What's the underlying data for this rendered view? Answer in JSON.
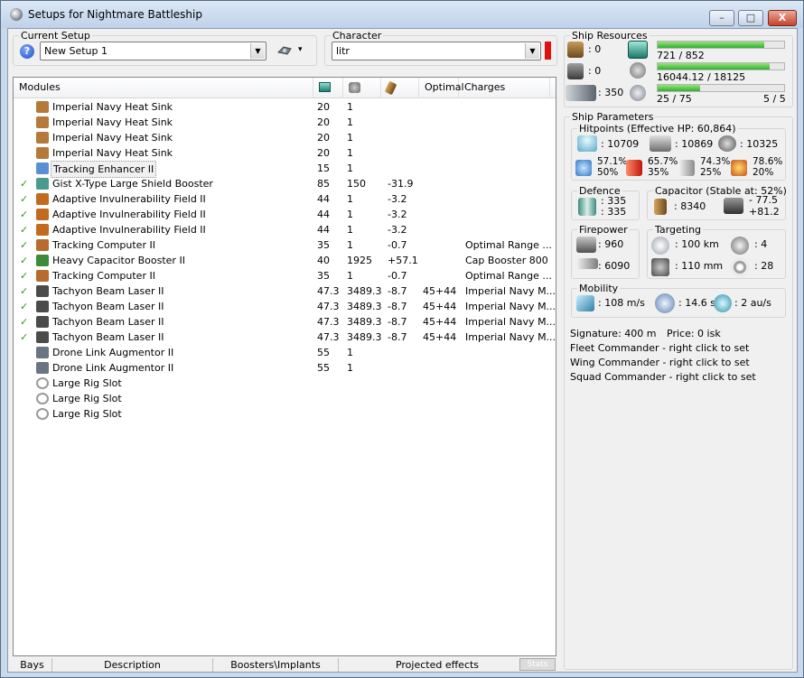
{
  "window": {
    "title": "Setups for Nightmare Battleship",
    "minimize": "–",
    "maximize": "□",
    "close": "X"
  },
  "current_setup": {
    "label": "Current Setup",
    "help": "?",
    "value": "New Setup 1",
    "drone_menu": "▾"
  },
  "character": {
    "label": "Character",
    "value": "litr",
    "indicator_color": "#e01010"
  },
  "modules": {
    "headers": [
      "Modules",
      "",
      "",
      "",
      "Optimal",
      "Charges"
    ],
    "header_icons": [
      "cpu-icon",
      "powergrid-icon",
      "capacitor-icon"
    ],
    "rows": [
      {
        "check": "",
        "icon": "heat-sink-icon",
        "name": "Imperial Navy Heat Sink",
        "c1": "20",
        "c2": "1",
        "c3": "",
        "c4": "",
        "c5": ""
      },
      {
        "check": "",
        "icon": "heat-sink-icon",
        "name": "Imperial Navy Heat Sink",
        "c1": "20",
        "c2": "1",
        "c3": "",
        "c4": "",
        "c5": ""
      },
      {
        "check": "",
        "icon": "heat-sink-icon",
        "name": "Imperial Navy Heat Sink",
        "c1": "20",
        "c2": "1",
        "c3": "",
        "c4": "",
        "c5": ""
      },
      {
        "check": "",
        "icon": "heat-sink-icon",
        "name": "Imperial Navy Heat Sink",
        "c1": "20",
        "c2": "1",
        "c3": "",
        "c4": "",
        "c5": ""
      },
      {
        "check": "",
        "icon": "tracking-enhancer-icon",
        "name": "Tracking Enhancer II",
        "c1": "15",
        "c2": "1",
        "c3": "",
        "c4": "",
        "c5": "",
        "selected": true
      },
      {
        "check": "✓",
        "icon": "shield-booster-icon",
        "name": "Gist X-Type Large Shield Booster",
        "c1": "85",
        "c2": "150",
        "c3": "-31.9",
        "c4": "",
        "c5": ""
      },
      {
        "check": "✓",
        "icon": "invulnerability-field-icon",
        "name": "Adaptive Invulnerability Field II",
        "c1": "44",
        "c2": "1",
        "c3": "-3.2",
        "c4": "",
        "c5": ""
      },
      {
        "check": "✓",
        "icon": "invulnerability-field-icon",
        "name": "Adaptive Invulnerability Field II",
        "c1": "44",
        "c2": "1",
        "c3": "-3.2",
        "c4": "",
        "c5": ""
      },
      {
        "check": "✓",
        "icon": "invulnerability-field-icon",
        "name": "Adaptive Invulnerability Field II",
        "c1": "44",
        "c2": "1",
        "c3": "-3.2",
        "c4": "",
        "c5": ""
      },
      {
        "check": "✓",
        "icon": "tracking-computer-icon",
        "name": "Tracking Computer II",
        "c1": "35",
        "c2": "1",
        "c3": "-0.7",
        "c4": "",
        "c5": "Optimal Range ..."
      },
      {
        "check": "✓",
        "icon": "capacitor-booster-icon",
        "name": "Heavy Capacitor Booster II",
        "c1": "40",
        "c2": "1925",
        "c3": "+57.1",
        "c4": "",
        "c5": "Cap Booster 800"
      },
      {
        "check": "✓",
        "icon": "tracking-computer-icon",
        "name": "Tracking Computer II",
        "c1": "35",
        "c2": "1",
        "c3": "-0.7",
        "c4": "",
        "c5": "Optimal Range ..."
      },
      {
        "check": "✓",
        "icon": "beam-laser-icon",
        "name": "Tachyon Beam Laser II",
        "c1": "47.3",
        "c2": "3489.3",
        "c3": "-8.7",
        "c4": "45+44",
        "c5": "Imperial Navy M..."
      },
      {
        "check": "✓",
        "icon": "beam-laser-icon",
        "name": "Tachyon Beam Laser II",
        "c1": "47.3",
        "c2": "3489.3",
        "c3": "-8.7",
        "c4": "45+44",
        "c5": "Imperial Navy M..."
      },
      {
        "check": "✓",
        "icon": "beam-laser-icon",
        "name": "Tachyon Beam Laser II",
        "c1": "47.3",
        "c2": "3489.3",
        "c3": "-8.7",
        "c4": "45+44",
        "c5": "Imperial Navy M..."
      },
      {
        "check": "✓",
        "icon": "beam-laser-icon",
        "name": "Tachyon Beam Laser II",
        "c1": "47.3",
        "c2": "3489.3",
        "c3": "-8.7",
        "c4": "45+44",
        "c5": "Imperial Navy M..."
      },
      {
        "check": "",
        "icon": "drone-link-icon",
        "name": "Drone Link Augmentor II",
        "c1": "55",
        "c2": "1",
        "c3": "",
        "c4": "",
        "c5": ""
      },
      {
        "check": "",
        "icon": "drone-link-icon",
        "name": "Drone Link Augmentor II",
        "c1": "55",
        "c2": "1",
        "c3": "",
        "c4": "",
        "c5": ""
      },
      {
        "check": "",
        "icon": "rig-slot-icon",
        "name": "Large Rig Slot",
        "c1": "",
        "c2": "",
        "c3": "",
        "c4": "",
        "c5": ""
      },
      {
        "check": "",
        "icon": "rig-slot-icon",
        "name": "Large Rig Slot",
        "c1": "",
        "c2": "",
        "c3": "",
        "c4": "",
        "c5": ""
      },
      {
        "check": "",
        "icon": "rig-slot-icon",
        "name": "Large Rig Slot",
        "c1": "",
        "c2": "",
        "c3": "",
        "c4": "",
        "c5": ""
      }
    ]
  },
  "bottom_tabs": [
    "Bays",
    "Description",
    "Boosters\\Implants",
    "Projected effects"
  ],
  "stats_button": "Stats",
  "ship_resources": {
    "label": "Ship Resources",
    "turret_slots": ": 0",
    "launcher_slots": ": 0",
    "drone_bay": ": 350",
    "cpu": {
      "text": "721 / 852",
      "fraction": 0.846
    },
    "powergrid": {
      "text": "16044.12 / 18125",
      "fraction": 0.885
    },
    "drone_bandwidth": {
      "text": "25 / 75",
      "fraction": 0.333,
      "drones_active": "5 / 5"
    }
  },
  "ship_parameters": {
    "label": "Ship Parameters",
    "hitpoints": {
      "label": "Hitpoints (Effective HP: 60,864)",
      "shield": ": 10709",
      "armor": ": 10869",
      "hull": ": 10325",
      "resists": [
        {
          "top": "57.1%",
          "bottom": "50%"
        },
        {
          "top": "65.7%",
          "bottom": "35%"
        },
        {
          "top": "74.3%",
          "bottom": "25%"
        },
        {
          "top": "78.6%",
          "bottom": "20%"
        }
      ]
    },
    "defence": {
      "label": "Defence",
      "top": ": 335",
      "bottom": ": 335"
    },
    "capacitor": {
      "label": "Capacitor (Stable at: 52%)",
      "amount": ": 8340",
      "top": "- 77.5",
      "bottom": "+81.2"
    },
    "firepower": {
      "label": "Firepower",
      "volley": ": 960",
      "dps": ": 6090"
    },
    "targeting": {
      "label": "Targeting",
      "range": ": 100 km",
      "max_targets": ": 4",
      "scan_res": ": 110 mm",
      "sensor": ": 28"
    },
    "mobility": {
      "label": "Mobility",
      "velocity": ": 108 m/s",
      "align": ": 14.6 s",
      "warp": ": 2 au/s"
    },
    "signature": "Signature: 400 m",
    "price": "Price: 0 isk",
    "fleet_commander": "Fleet Commander - right click to set",
    "wing_commander": "Wing Commander - right click to set",
    "squad_commander": "Squad Commander - right click to set"
  },
  "colors": {
    "heat-sink-icon": "#b5793a",
    "tracking-enhancer-icon": "#5a8fd6",
    "shield-booster-icon": "#4a9a8e",
    "invulnerability-field-icon": "#c26a1e",
    "tracking-computer-icon": "#b86b2c",
    "capacitor-booster-icon": "#3d8a3a",
    "beam-laser-icon": "#4b4b4b",
    "drone-link-icon": "#6a7482",
    "rig-slot-icon": "#d8d8d8"
  }
}
